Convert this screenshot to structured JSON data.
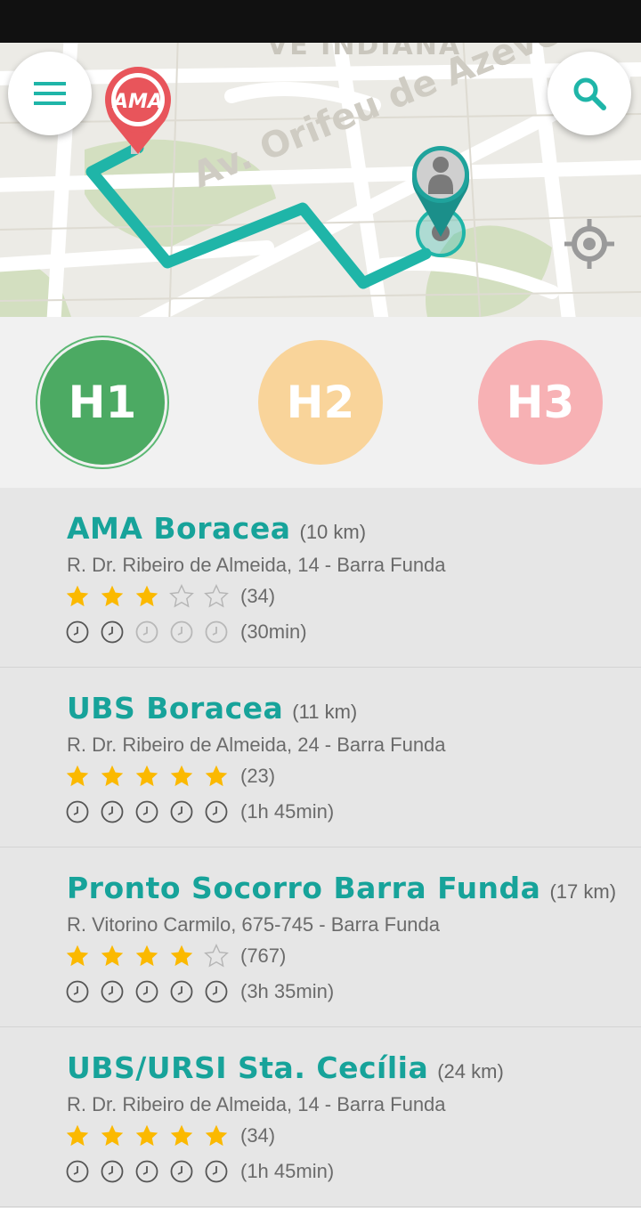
{
  "map": {
    "street_top": "VE INDIANA",
    "street_av": "Av. Orifeu de Azevedo",
    "origin_pin_label": "AMA",
    "route_color": "#1fb5a8",
    "pin_color": "#e8555b"
  },
  "toolbar": {
    "menu_icon": "hamburger-menu-icon",
    "search_icon": "search-icon",
    "locate_icon": "crosshair-icon"
  },
  "tabs": [
    {
      "label": "H1",
      "color": "#4caa63",
      "selected": true
    },
    {
      "label": "H2",
      "color": "#f9d49a",
      "selected": false
    },
    {
      "label": "H3",
      "color": "#f7b1b4",
      "selected": false
    }
  ],
  "places": [
    {
      "name": "AMA Boracea",
      "distance": "(10 km)",
      "address": "R. Dr. Ribeiro de Almeida, 14 - Barra Funda",
      "rating": 3,
      "reviews": "(34)",
      "wait_level": 2,
      "wait": "(30min)"
    },
    {
      "name": "UBS Boracea",
      "distance": "(11 km)",
      "address": "R. Dr. Ribeiro de Almeida, 24 - Barra Funda",
      "rating": 5,
      "reviews": "(23)",
      "wait_level": 5,
      "wait": "(1h 45min)"
    },
    {
      "name": "Pronto Socorro Barra Funda",
      "distance": "(17 km)",
      "address": "R. Vitorino Carmilo, 675-745 - Barra Funda",
      "rating": 4,
      "reviews": "(767)",
      "wait_level": 5,
      "wait": "(3h 35min)"
    },
    {
      "name": "UBS/URSI Sta. Cecília",
      "distance": "(24 km)",
      "address": "R. Dr. Ribeiro de Almeida, 14 - Barra Funda",
      "rating": 5,
      "reviews": "(34)",
      "wait_level": 5,
      "wait": "(1h 45min)"
    }
  ]
}
